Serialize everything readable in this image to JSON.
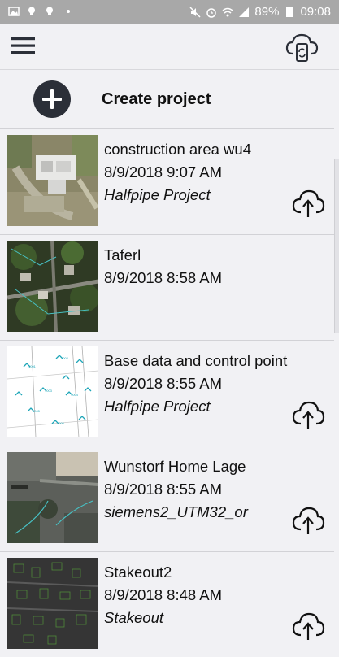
{
  "status_bar": {
    "battery": "89%",
    "time": "09:08"
  },
  "header": {
    "menu_icon": "hamburger-menu-icon",
    "sync_icon": "cloud-sync-icon"
  },
  "create": {
    "label": "Create project",
    "icon": "plus-circle-icon"
  },
  "projects": [
    {
      "title": "construction area wu4",
      "date": "8/9/2018 9:07 AM",
      "subtitle": "Halfpipe Project",
      "upload": true,
      "thumb": "aerial-building"
    },
    {
      "title": "Taferl",
      "date": "8/9/2018 8:58 AM",
      "subtitle": "",
      "upload": false,
      "thumb": "aerial-residential"
    },
    {
      "title": "Base data and control point",
      "date": "8/9/2018 8:55 AM",
      "subtitle": "Halfpipe Project",
      "upload": true,
      "thumb": "survey-points"
    },
    {
      "title": "Wunstorf Home Lage",
      "date": "8/9/2018 8:55 AM",
      "subtitle": "siemens2_UTM32_or",
      "upload": true,
      "thumb": "aerial-parking"
    },
    {
      "title": "Stakeout2",
      "date": "8/9/2018 8:48 AM",
      "subtitle": "Stakeout",
      "upload": true,
      "thumb": "dark-parcels"
    }
  ]
}
